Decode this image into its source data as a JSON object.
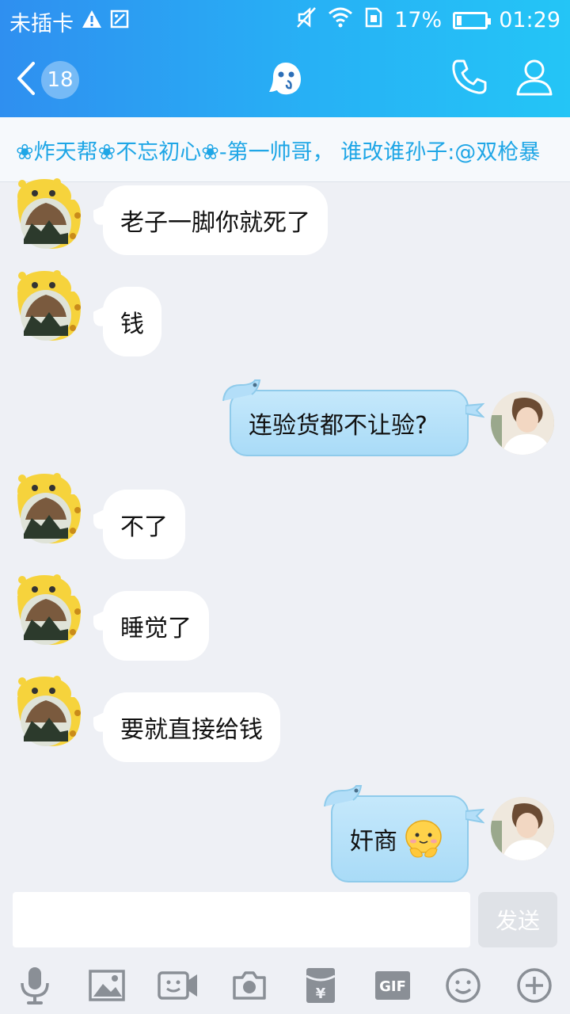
{
  "status_bar": {
    "carrier": "未插卡",
    "battery_percent": "17%",
    "battery_level": 0.17,
    "time": "01:29"
  },
  "title_bar": {
    "unread_count": "18",
    "icons": [
      "back-chevron-icon",
      "qq-ghost-icon",
      "phone-icon",
      "user-icon"
    ]
  },
  "announcement": {
    "text": "❀炸天帮❀不忘初心❀-第一帅哥， 谁改谁孙子:@双枪暴"
  },
  "messages": [
    {
      "side": "left",
      "text": "老子一脚你就死了"
    },
    {
      "side": "left",
      "text": "钱"
    },
    {
      "side": "right",
      "text": "连验货都不让验?"
    },
    {
      "side": "left",
      "text": "不了"
    },
    {
      "side": "left",
      "text": "睡觉了"
    },
    {
      "side": "left",
      "text": "要就直接给钱"
    },
    {
      "side": "right",
      "text": "奸商",
      "emoji": "smiling-emoji"
    }
  ],
  "input": {
    "value": "",
    "send_label": "发送"
  },
  "toolbar": {
    "icons": [
      "microphone-icon",
      "image-icon",
      "video-call-icon",
      "camera-icon",
      "red-packet-icon",
      "gif-icon",
      "emoji-icon",
      "plus-icon"
    ],
    "gif_label": "GIF"
  },
  "colors": {
    "header_start": "#2f8ff0",
    "header_end": "#24c5f6",
    "announcement_text": "#1fa6e6",
    "chat_background": "#eef0f5",
    "right_bubble": "#b8e1f9"
  }
}
